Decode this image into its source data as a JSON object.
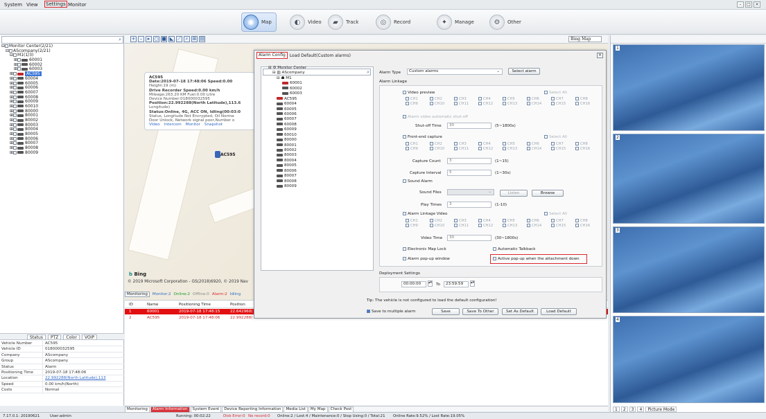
{
  "menu": {
    "items": [
      "System",
      "View",
      "Settings",
      "Monitor"
    ]
  },
  "nav": {
    "map": "Map",
    "video": "Video",
    "track": "Track",
    "record": "Record",
    "manage": "Manage",
    "other": "Other"
  },
  "tree": {
    "root": "Monitor Center(2/21)",
    "company": "AScompany(2/21)",
    "group": "M1(1/3)",
    "vehicles": [
      "60001",
      "60002",
      "60003",
      "AC595",
      "60004",
      "60005",
      "60006",
      "60007",
      "60008",
      "60009",
      "60010",
      "80000",
      "80001",
      "80002",
      "80003",
      "80004",
      "80005",
      "80006",
      "80007",
      "80008",
      "80009"
    ]
  },
  "status_tabs": [
    "Status",
    "PTZ",
    "Color",
    "VOIP"
  ],
  "vehicle_info": [
    {
      "k": "Vehicle Number",
      "v": "AC595"
    },
    {
      "k": "Vehicle ID",
      "v": "018000032595"
    },
    {
      "k": "Company",
      "v": "AScompany"
    },
    {
      "k": "Group",
      "v": "AScompany"
    },
    {
      "k": "Status",
      "v": "Alarm"
    },
    {
      "k": "Positioning Time",
      "v": "2019-07-18 17:48:06"
    },
    {
      "k": "Location",
      "v": "22.992288(North Latitude),113"
    },
    {
      "k": "Speed",
      "v": "0.00 km/h(North)"
    },
    {
      "k": "Costs",
      "v": "Normal"
    }
  ],
  "map": {
    "provider": "Bing Map",
    "bing": "Bing",
    "copyright": "© 2019 Microsoft Corporation - GS(2018)6920, © 2019 Nav",
    "vehicle_label": "AC595"
  },
  "popup": {
    "title": "AC595",
    "lines": [
      "Date:2019-07-18 17:48:06   Speed:0.00",
      "Height:19 (m)",
      "Drive Recorder Speed:0.00 km/h",
      "Mileage:263.20 KM   Fuel:0.00 Litre",
      "Device Number:018000032595",
      "Position:22.992288(North Latitude),113.6",
      "Longitude)",
      "Status:Online, 4G, ACC ON, Idling(00:03:0",
      "Status, Longitude Not Encrypted, Oil Norma",
      "Door Unlock, Network signal poor,Number o"
    ],
    "links": [
      "Video",
      "Intercom",
      "Monitor",
      "Snapshot"
    ]
  },
  "monitor": {
    "mode": "Monitoring",
    "monitor": "Monitor:2",
    "online": "Online:2",
    "offline": "Offline:0",
    "alarm": "Alarm:2",
    "idling": "Idling"
  },
  "grid": {
    "headers": [
      "ID",
      "Name",
      "Positioning Time",
      "Position"
    ],
    "rows": [
      [
        "1",
        "60001",
        "2019-07-18 17:48:15",
        "22.642960("
      ],
      [
        "2",
        "AC595",
        "2019-07-18 17:48:06",
        "22.992288("
      ]
    ]
  },
  "bottom_tabs": [
    "Monitoring",
    "Alarm Information",
    "System Event",
    "Device Reporting Information",
    "Media List",
    "My Map",
    "Check Post"
  ],
  "statusbar": {
    "version": "7.17.0.1: 20190621",
    "user": "User:admin",
    "running": "Running: 00:02:22",
    "disk": "Disk Error:0",
    "norecord": "No record:0",
    "online": "Online:2 / Lost:4 / Maintenance:0 / Stop Using:0 / Total:21",
    "rate": "Online Rate:9.52% / Lost Rate:19.05%"
  },
  "video": {
    "cells": [
      "1",
      "2",
      "3",
      "4"
    ],
    "tabs": [
      "1",
      "2",
      "3",
      "4"
    ],
    "mode": "Picture Mode"
  },
  "dialog": {
    "tab_config": "Alarm Config",
    "tab_default": "Load Default(Custom alarms)",
    "close": "×",
    "tree": {
      "root": "Monitor Center",
      "company": "AScompany",
      "group": "M1",
      "vehicles": [
        "60001",
        "60002",
        "60003",
        "AC595",
        "60004",
        "60005",
        "60006",
        "60007",
        "60008",
        "60009",
        "60010",
        "80000",
        "80001",
        "80002",
        "80003",
        "80004",
        "80005",
        "80006",
        "80007",
        "80008",
        "80009"
      ]
    },
    "alarm_type_label": "Alarm Type",
    "alarm_type": "Custom alarms",
    "select_alarm": "Select alarm",
    "linkage_title": "Alarm Linkage",
    "video_preview": "Video preview",
    "select_all": "Select All",
    "channels": [
      "CH1",
      "CH2",
      "CH3",
      "CH4",
      "CH5",
      "CH6",
      "CH7",
      "CH8",
      "CH9",
      "CH10",
      "CH11",
      "CH12",
      "CH13",
      "CH14",
      "CH15",
      "CH16"
    ],
    "auto_shutoff": "Alarm video automatic shut-off",
    "shutoff_time": "Shut-off Time",
    "shutoff_val": "30",
    "shutoff_range": "(5~1800s)",
    "front_capture": "Front-end capture",
    "capture_count": "Capture Count",
    "capture_count_val": "3",
    "capture_count_range": "(1~15)",
    "capture_interval": "Capture Interval",
    "capture_interval_val": "5",
    "capture_interval_range": "(1~30s)",
    "sound_alarm": "Sound Alarm",
    "sound_files": "Sound Files",
    "listen": "Listen",
    "browse": "Browse",
    "play_times": "Play Times",
    "play_times_val": "3",
    "play_times_range": "(1-10)",
    "linkage_video": "Alarm Linkage Video",
    "video_time": "Video Time",
    "video_time_val": "30",
    "video_time_range": "(30~1800s)",
    "map_lock": "Electronic Map Lock",
    "auto_talkback": "Automatic Talkback",
    "popup_window": "Alarm pop-up window",
    "active_popup": "Active pop-up when the attachment down",
    "deploy_title": "Deployment Settings",
    "from": "00:00:00",
    "to_label": "To",
    "to": "23:59:59",
    "tip": "Tip: The vehicle is not configured to load the default configuration!",
    "save_multi": "Save to multiple alarm",
    "save": "Save",
    "save_other": "Save To Other",
    "set_default": "Set As Default",
    "load_default": "Load Default"
  }
}
